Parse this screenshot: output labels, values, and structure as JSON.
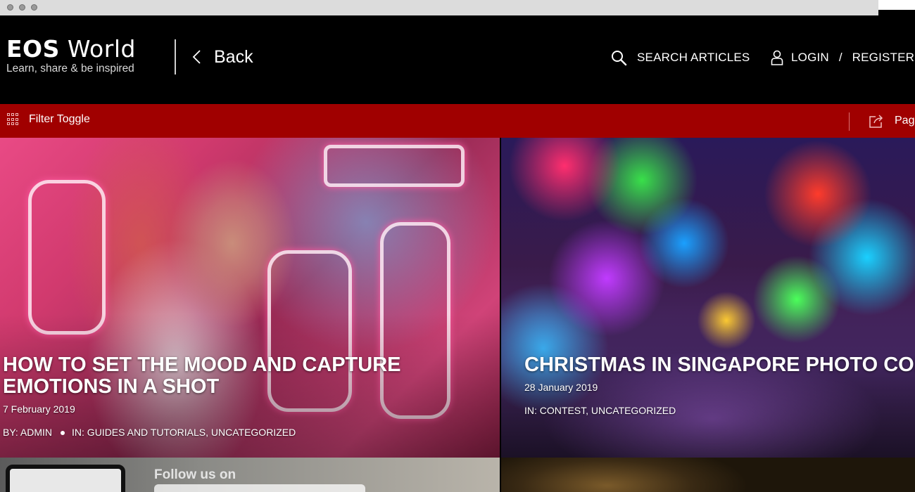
{
  "header": {
    "logo_title_bold": "EOS",
    "logo_title_rest": " World",
    "logo_tagline": "Learn, share & be inspired",
    "back_label": "Back",
    "search_label": "SEARCH ARTICLES",
    "login_label": "LOGIN",
    "separator": "/",
    "register_label": "REGISTER"
  },
  "filterbar": {
    "filter_label": "Filter Toggle",
    "page_share_label": "Pag"
  },
  "articles": [
    {
      "title": "HOW TO SET THE MOOD AND CAPTURE EMOTIONS IN A SHOT",
      "date": "7 February 2019",
      "author": "BY: ADMIN",
      "categories": "IN: GUIDES AND TUTORIALS, UNCATEGORIZED"
    },
    {
      "title": "CHRISTMAS IN SINGAPORE PHOTO CONTEST WINNER",
      "date": "28 January 2019",
      "categories": "IN: CONTEST, UNCATEGORIZED"
    },
    {
      "partial_text": "Follow us on"
    }
  ],
  "colors": {
    "header_bg": "#000000",
    "filterbar_bg": "#a00000",
    "text": "#ffffff"
  },
  "icons": [
    "search-icon",
    "user-icon",
    "grid-icon",
    "share-icon",
    "chevron-left-icon"
  ]
}
